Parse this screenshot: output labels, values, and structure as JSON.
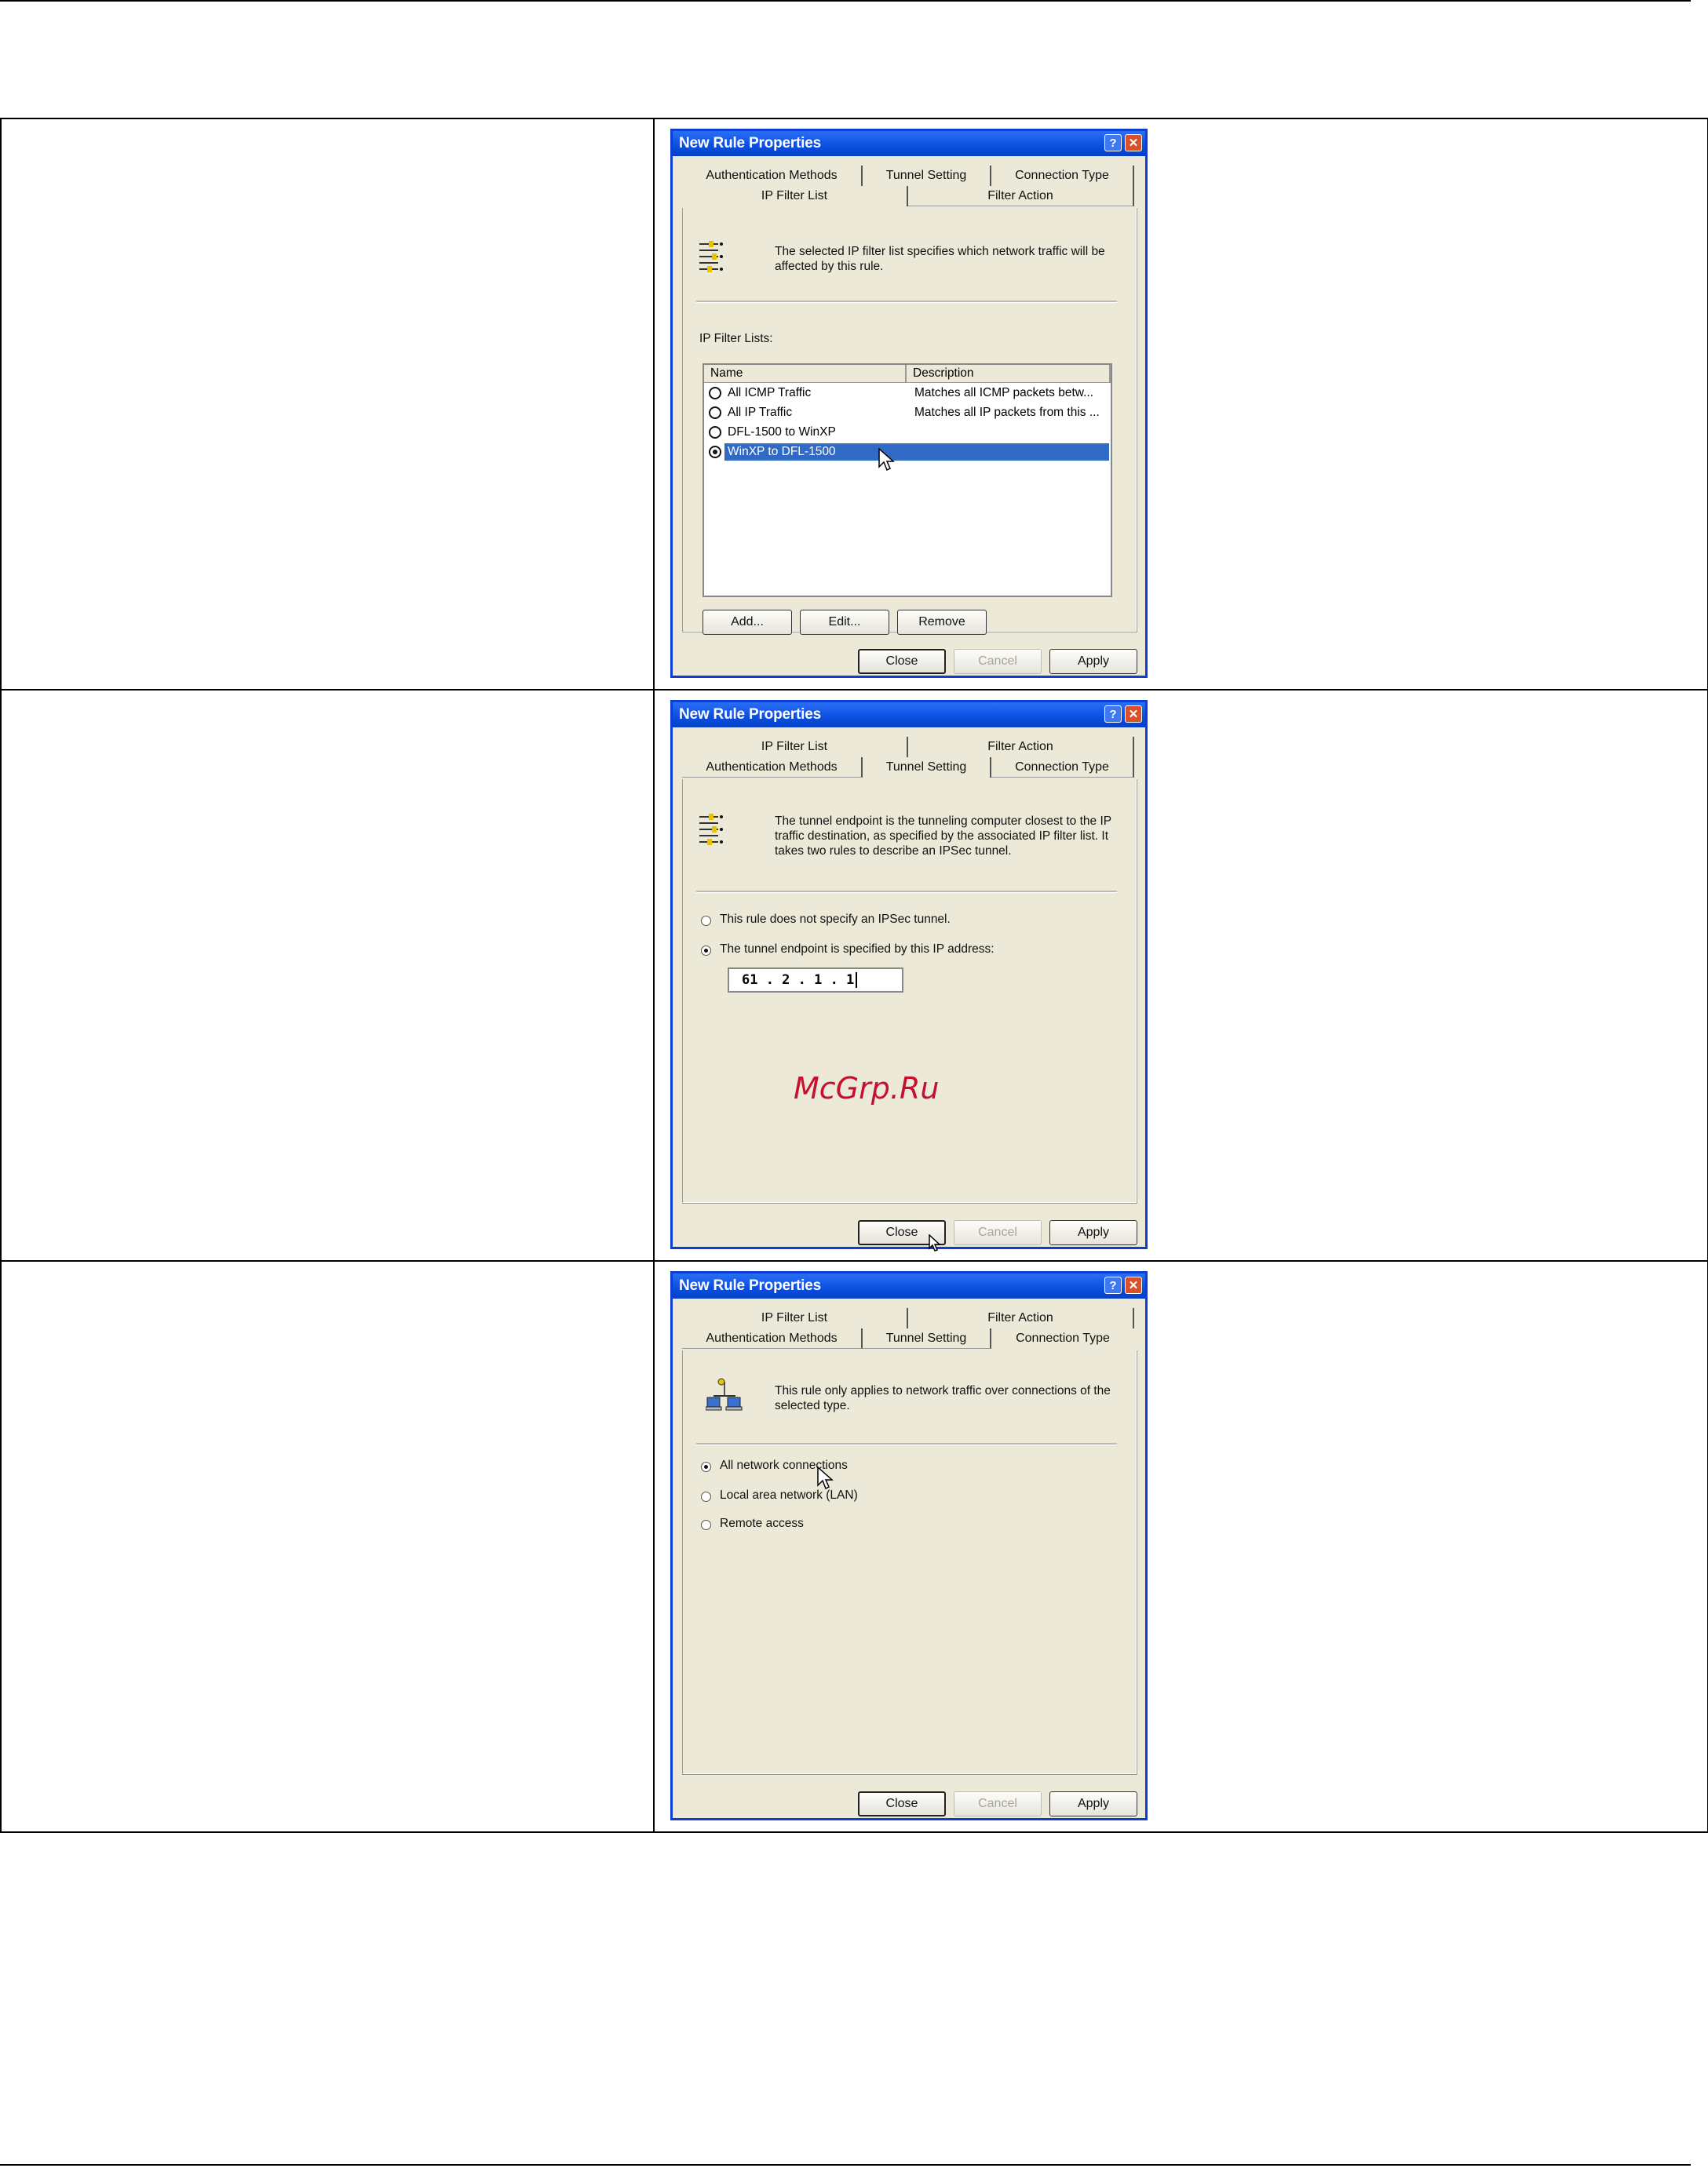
{
  "dialog_title": "New Rule Properties",
  "tabs": {
    "authentication": "Authentication Methods",
    "tunnel": "Tunnel Setting",
    "connection": "Connection Type",
    "ipfilter": "IP Filter List",
    "filteraction": "Filter Action"
  },
  "buttons": {
    "close": "Close",
    "cancel": "Cancel",
    "apply": "Apply",
    "add": "Add...",
    "edit": "Edit...",
    "remove": "Remove"
  },
  "panel1": {
    "description": "The selected IP filter list specifies which network traffic will be affected by this rule.",
    "list_label": "IP Filter Lists:",
    "columns": [
      "Name",
      "Description"
    ],
    "rows": [
      {
        "name": "All ICMP Traffic",
        "desc": "Matches all ICMP packets betw..."
      },
      {
        "name": "All IP Traffic",
        "desc": "Matches all IP packets from this ..."
      },
      {
        "name": "DFL-1500 to WinXP",
        "desc": ""
      },
      {
        "name": "WinXP to DFL-1500",
        "desc": ""
      }
    ]
  },
  "panel2": {
    "description": "The tunnel endpoint is the tunneling computer closest to the IP traffic destination, as specified by the associated IP filter list. It takes two rules to describe an IPSec tunnel.",
    "option1": "This rule does not specify an IPSec tunnel.",
    "option2": "The tunnel endpoint is specified by this IP address:",
    "ip": "61  .  2  .  1  .  1",
    "watermark": "McGrp.Ru"
  },
  "panel3": {
    "description": "This rule only applies to network traffic over connections of the selected type.",
    "option1": "All network connections",
    "option2": "Local area network (LAN)",
    "option3": "Remote access"
  }
}
